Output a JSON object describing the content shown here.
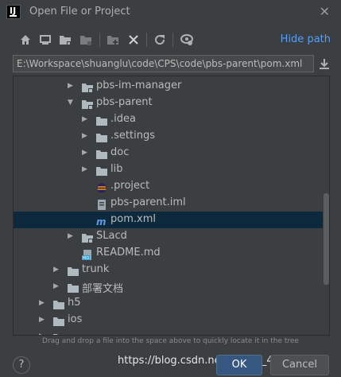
{
  "window": {
    "title": "Open File or Project",
    "logo_text": "IJ"
  },
  "toolbar": {
    "icons": [
      "home-icon",
      "desktop-icon",
      "project-folder-icon",
      "module-folder-icon",
      "new-folder-icon",
      "delete-icon",
      "refresh-icon",
      "show-hidden-icon"
    ],
    "hide_path_label": "Hide path"
  },
  "path": {
    "value": "E:\\Workspace\\shuanglu\\code\\CPS\\code\\pbs-parent\\pom.xml"
  },
  "tree": {
    "items": [
      {
        "label": "pbs-im-manager",
        "type": "module",
        "expanded": false,
        "depth": 4
      },
      {
        "label": "pbs-parent",
        "type": "module",
        "expanded": true,
        "depth": 4
      },
      {
        "label": ".idea",
        "type": "folder",
        "expanded": false,
        "depth": 5
      },
      {
        "label": ".settings",
        "type": "folder",
        "expanded": false,
        "depth": 5
      },
      {
        "label": "doc",
        "type": "folder",
        "expanded": false,
        "depth": 5
      },
      {
        "label": "lib",
        "type": "folder",
        "expanded": false,
        "depth": 5
      },
      {
        "label": ".project",
        "type": "eclipse",
        "depth": 5
      },
      {
        "label": "pbs-parent.iml",
        "type": "iml",
        "depth": 5
      },
      {
        "label": "pom.xml",
        "type": "maven",
        "depth": 5,
        "selected": true
      },
      {
        "label": "SLacd",
        "type": "module",
        "expanded": false,
        "depth": 4
      },
      {
        "label": "README.md",
        "type": "md",
        "depth": 4
      },
      {
        "label": "trunk",
        "type": "folder",
        "expanded": false,
        "depth": 3
      },
      {
        "label": "部署文档",
        "type": "folder",
        "expanded": false,
        "depth": 3
      },
      {
        "label": "h5",
        "type": "folder",
        "expanded": false,
        "depth": 2
      },
      {
        "label": "ios",
        "type": "folder",
        "expanded": false,
        "depth": 2
      },
      {
        "label": "",
        "type": "folder",
        "expanded": false,
        "depth": 2
      }
    ]
  },
  "hint": "Drag and drop a file into the space above to quickly locate it in the tree",
  "buttons": {
    "help": "?",
    "ok": "OK",
    "cancel": "Cancel"
  },
  "watermark": "https://blog.csdn.net/weixin_44599202",
  "colors": {
    "background": "#3c3f41",
    "selection": "#0d293e",
    "link": "#589df6",
    "folder": "#aeb9c0",
    "maven": "#5d9be0"
  }
}
